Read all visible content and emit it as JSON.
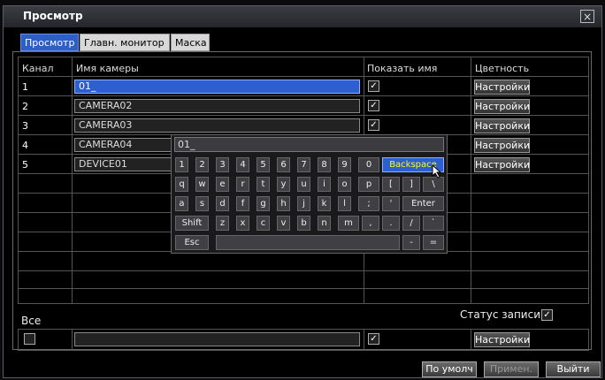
{
  "window": {
    "title": "Просмотр",
    "close_label": "×"
  },
  "tabs": [
    {
      "label": "Просмотр"
    },
    {
      "label": "Главн. монитор"
    },
    {
      "label": "Маска"
    }
  ],
  "table": {
    "headers": {
      "channel": "Канал",
      "name": "Имя камеры",
      "show": "Показать имя",
      "color": "Цветность"
    },
    "rows": [
      {
        "ch": "1",
        "name": "01_",
        "show": "✓",
        "color_btn": "Настройки"
      },
      {
        "ch": "2",
        "name": "CAMERA02",
        "show": "✓",
        "color_btn": "Настройки"
      },
      {
        "ch": "3",
        "name": "CAMERA03",
        "show": "✓",
        "color_btn": "Настройки"
      },
      {
        "ch": "4",
        "name": "CAMERA04",
        "show": "",
        "color_btn": "Настройки"
      },
      {
        "ch": "5",
        "name": "DEVICE01",
        "show": "",
        "color_btn": "Настройки"
      }
    ]
  },
  "keyboard": {
    "input_value": "01_",
    "row1": [
      "1",
      "2",
      "3",
      "4",
      "5",
      "6",
      "7",
      "8",
      "9",
      "0",
      "Backspace"
    ],
    "row2": [
      "q",
      "w",
      "e",
      "r",
      "t",
      "y",
      "u",
      "i",
      "o",
      "p",
      "[",
      "]",
      "\\"
    ],
    "row3": [
      "a",
      "s",
      "d",
      "f",
      "g",
      "h",
      "j",
      "k",
      "l",
      ";",
      "'",
      "Enter"
    ],
    "row4": [
      "Shift",
      "z",
      "x",
      "c",
      "v",
      "b",
      "n",
      "m",
      ",",
      ".",
      "/",
      "`"
    ],
    "row5": [
      "Esc",
      "-",
      "="
    ]
  },
  "bottom": {
    "all_label": "Все",
    "record_status_label": "Статус записи",
    "record_status_check": "✓",
    "all_show_check": "✓",
    "all_color_btn": "Настройки"
  },
  "footer": {
    "default_btn": "По умолч",
    "apply_btn": "Примен.",
    "exit_btn": "Выйти"
  },
  "colors": {
    "accent": "#2d5fd0",
    "highlight_text": "#ffff00"
  }
}
